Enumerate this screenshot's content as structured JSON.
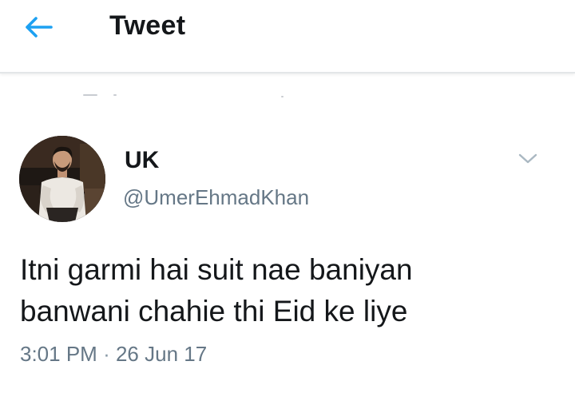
{
  "colors": {
    "accent": "#1da1f2",
    "text_primary": "#14171a",
    "text_secondary": "#657786",
    "divider": "#e3e6e8"
  },
  "header": {
    "back_icon": "back-arrow-icon",
    "title": "Tweet"
  },
  "tweet": {
    "avatar_icon": "avatar",
    "display_name": "UK",
    "handle": "@UmerEhmadKhan",
    "menu_icon": "chevron-down-icon",
    "text": "Itni garmi hai suit nae baniyan\nbanwani chahie thi Eid ke liye",
    "time": "3:01 PM",
    "separator": "·",
    "date": "26 Jun 17"
  }
}
